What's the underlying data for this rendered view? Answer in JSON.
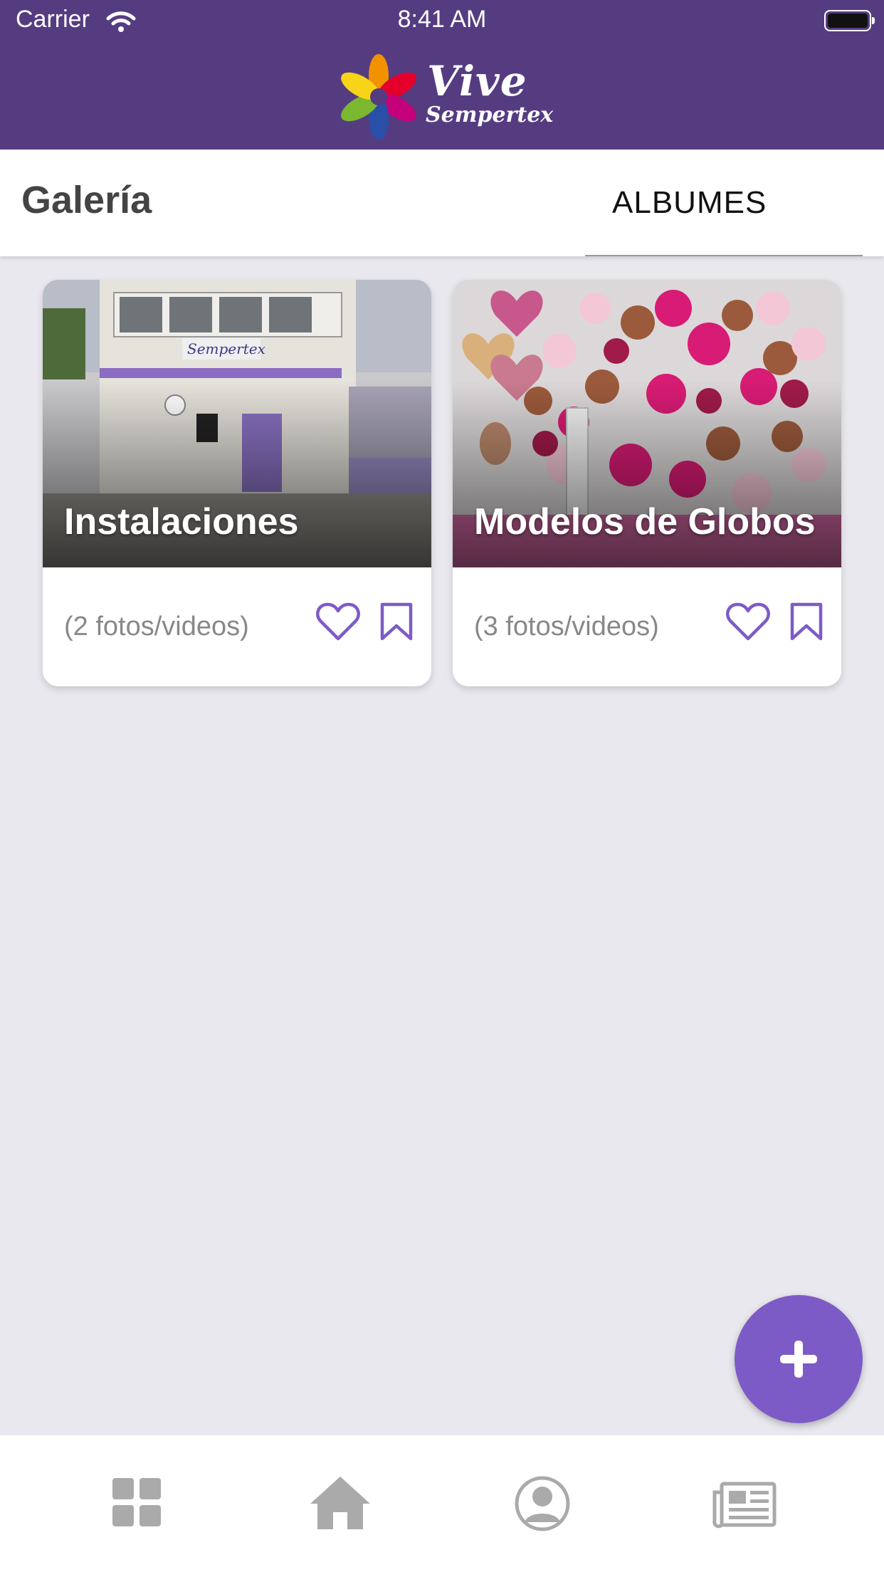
{
  "status_bar": {
    "carrier": "Carrier",
    "time": "8:41 AM"
  },
  "header": {
    "logo_script": "Vive",
    "logo_brand": "Sempertex",
    "background_color": "#553c81"
  },
  "gallery": {
    "title": "Galería",
    "tab_label": "ALBUMES"
  },
  "albums": [
    {
      "title": "Instalaciones",
      "count_label": "(2 fotos/videos)"
    },
    {
      "title": "Modelos de Globos",
      "count_label": "(3 fotos/videos)"
    }
  ],
  "icons": {
    "like": "heart-icon",
    "save": "bookmark-icon",
    "add": "plus-icon",
    "nav": [
      "grid-icon",
      "home-icon",
      "user-icon",
      "newspaper-icon"
    ]
  },
  "colors": {
    "accent": "#7d5bc6",
    "nav_icon": "#aaaaaa"
  }
}
